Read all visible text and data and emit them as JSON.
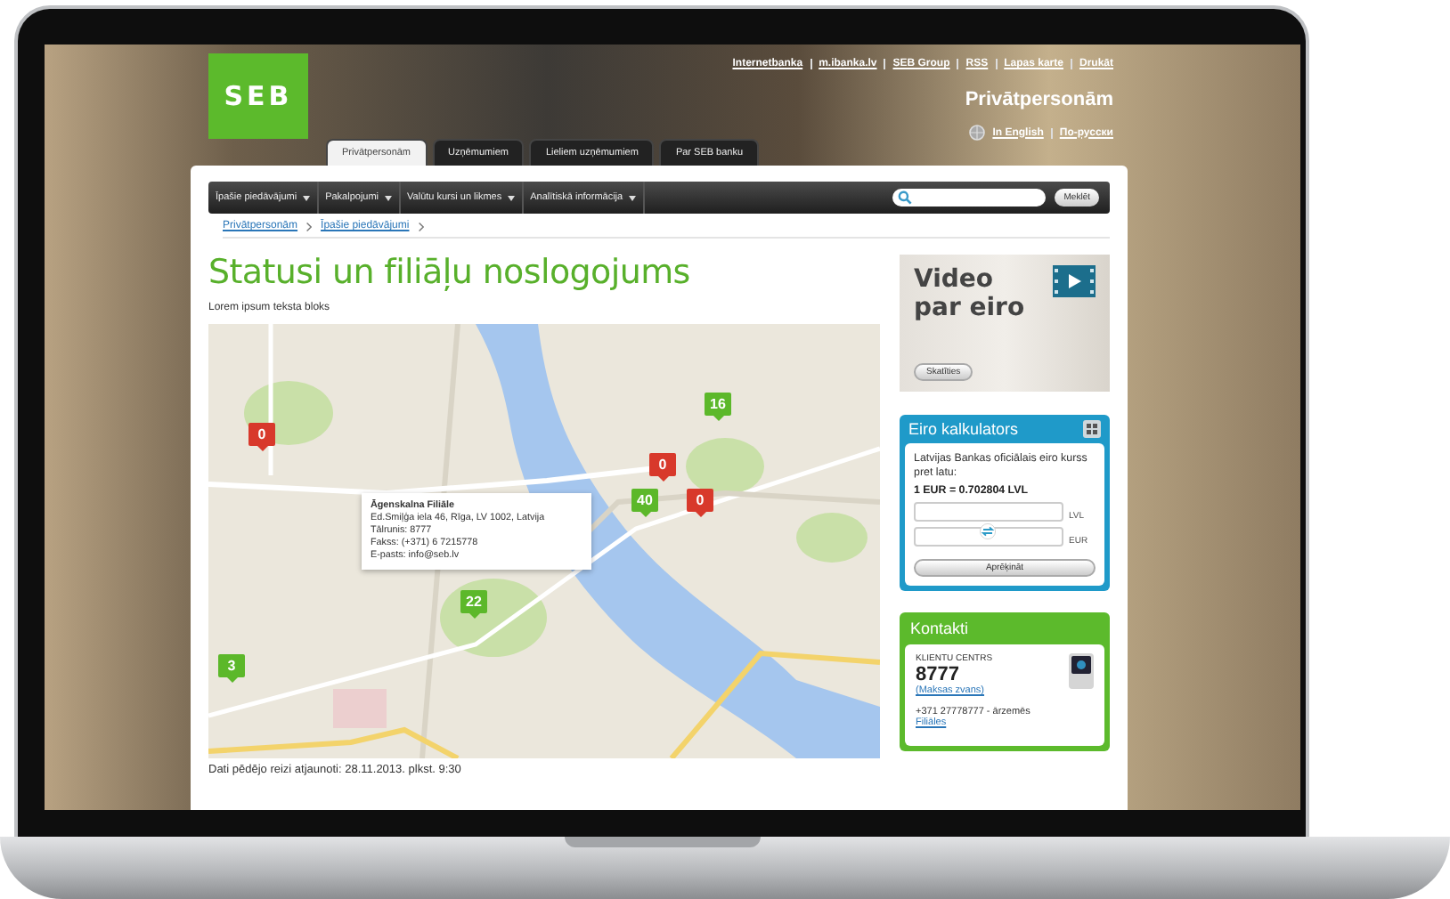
{
  "header": {
    "logo": "SEB",
    "top_links": [
      "Internetbanka",
      "m.ibanka.lv",
      "SEB Group",
      "RSS",
      "Lapas karte",
      "Drukāt"
    ],
    "section_title": "Privātpersonām",
    "languages": [
      "In English",
      "По-русски"
    ]
  },
  "tabs": [
    {
      "label": "Privātpersonām",
      "selected": true
    },
    {
      "label": "Uzņēmumiem",
      "selected": false
    },
    {
      "label": "Lieliem uzņēmumiem",
      "selected": false
    },
    {
      "label": "Par SEB banku",
      "selected": false
    }
  ],
  "nav_menu": [
    "Īpašie piedāvājumi",
    "Pakalpojumi",
    "Valūtu kursi un likmes",
    "Analītiskā informācija"
  ],
  "search": {
    "button": "Meklēt"
  },
  "breadcrumb": [
    "Privātpersonām",
    "Īpašie piedāvājumi"
  ],
  "title": "Statusi un filiāļu noslogojums",
  "intro": "Lorem ipsum teksta bloks",
  "map": {
    "markers": [
      {
        "count": "0",
        "color": "#d8392b"
      },
      {
        "count": "16",
        "color": "#5cb82a"
      },
      {
        "count": "0",
        "color": "#d8392b"
      },
      {
        "count": "40",
        "color": "#5cb82a"
      },
      {
        "count": "0",
        "color": "#d8392b"
      },
      {
        "count": "22",
        "color": "#5cb82a"
      },
      {
        "count": "3",
        "color": "#5cb82a"
      }
    ],
    "popup": {
      "title": "Āgenskalna Filiāle",
      "lines": [
        "Ed.Smiļģa iela 46, Rīga, LV 1002, Latvija",
        "Tālrunis: 8777",
        "Fakss: (+371) 6 7215778",
        "E-pasts: info@seb.lv"
      ]
    }
  },
  "updated": "Dati pēdējo reizi atjaunoti: 28.11.2013. plkst. 9:30",
  "video": {
    "title": "Video par eiro",
    "button": "Skatīties"
  },
  "calculator": {
    "title": "Eiro kalkulators",
    "text": "Latvijas Bankas oficiālais eiro kurss pret latu:",
    "rate": "1 EUR = 0.702804 LVL",
    "fields": [
      "LVL",
      "EUR"
    ],
    "button": "Aprēķināt"
  },
  "contacts": {
    "title": "Kontakti",
    "label": "KLIENTU CENTRS",
    "phone": "8777",
    "note": "(Maksas zvans)",
    "abroad": "+371 27778777 - ārzemēs",
    "link": "Filiāles"
  }
}
